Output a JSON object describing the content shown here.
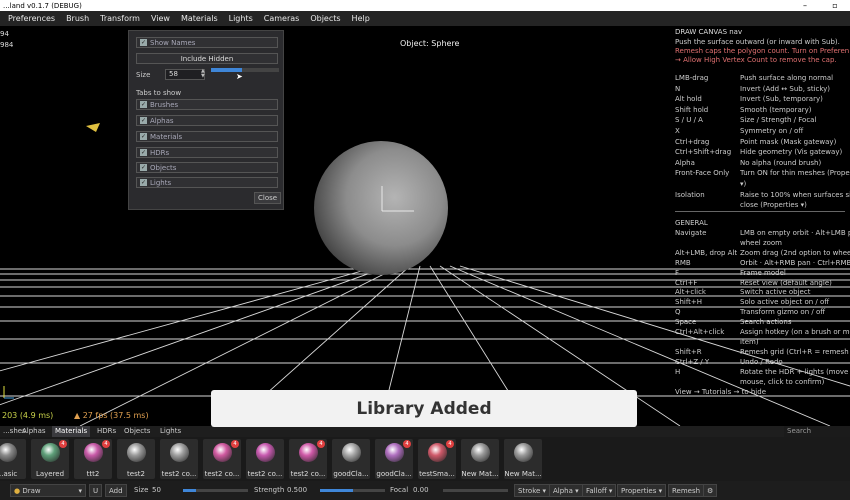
{
  "window": {
    "title": "...land v0.1.7 (DEBUG)",
    "minimize": "–",
    "maximize": "▫"
  },
  "menu": [
    "Preferences",
    "Brush",
    "Transform",
    "View",
    "Materials",
    "Lights",
    "Cameras",
    "Objects",
    "Help"
  ],
  "viewport": {
    "stats_top_left": [
      "94",
      "984"
    ],
    "object_label": "Object: Sphere",
    "fps_left": "203  (4.9 ms)",
    "fps_right": "▲  27 fps  (37.5 ms)"
  },
  "visibility_panel": {
    "show_names": "Show Names",
    "include_hidden": "Include Hidden",
    "size_label": "Size",
    "size_value": "58",
    "size_fraction": 0.45,
    "tabs_to_show": "Tabs to show",
    "tabs": [
      "Brushes",
      "Alphas",
      "Materials",
      "HDRs",
      "Objects",
      "Lights"
    ],
    "close": "Close"
  },
  "help": {
    "header": "DRAW    CANVAS nav",
    "intro": [
      "Push the surface outward (or inward with Sub).",
      "  Remesh caps the polygon count. Turn on Preferen",
      "→ Allow High Vertex Count to remove the cap."
    ],
    "rows": [
      {
        "key": "LMB-drag",
        "desc": "Push surface along normal"
      },
      {
        "key": "N",
        "desc": "Invert (Add ↔ Sub, sticky)"
      },
      {
        "key": "Alt hold",
        "desc": "Invert (Sub, temporary)"
      },
      {
        "key": "Shift hold",
        "desc": "Smooth (temporary)"
      },
      {
        "key": "S / U / A",
        "desc": "Size / Strength / Focal"
      },
      {
        "key": "X",
        "desc": "Symmetry on / off"
      },
      {
        "key": "Ctrl+drag",
        "desc": "Point mask (Mask gateway)"
      },
      {
        "key": "Ctrl+Shift+drag",
        "desc": "Hide geometry (Vis gateway)"
      },
      {
        "key": "Alpha",
        "desc": "No alpha (round brush)"
      },
      {
        "key": "Front-Face Only",
        "desc": "Turn ON for thin meshes (Propert"
      },
      {
        "key": "",
        "desc": "  ▾)"
      },
      {
        "key": "Isolation",
        "desc": "Raise to 100% when surfaces sit"
      },
      {
        "key": "",
        "desc": "close (Properties  ▾)"
      }
    ],
    "general": "GENERAL",
    "general_rows": [
      {
        "key": "Navigate",
        "desc": "LMB on empty orbit · Alt+LMB pa"
      },
      {
        "key": "",
        "desc": "wheel zoom"
      },
      {
        "key": "Alt+LMB, drop Alt",
        "desc": "Zoom drag (2nd option to whee"
      },
      {
        "key": "RMB",
        "desc": "Orbit · Alt+RMB pan · Ctrl+RMB z"
      },
      {
        "key": "F",
        "desc": "Frame model"
      },
      {
        "key": "Ctrl+F",
        "desc": "Reset view (default angle)"
      },
      {
        "key": "Alt+click",
        "desc": "Switch active object"
      },
      {
        "key": "Shift+H",
        "desc": "Solo active object on / off"
      },
      {
        "key": "Q",
        "desc": "Transform gizmo on / off"
      },
      {
        "key": "Space",
        "desc": "Search actions"
      },
      {
        "key": "Ctrl+Alt+click",
        "desc": "Assign hotkey (on a brush or men"
      },
      {
        "key": "",
        "desc": "item)"
      },
      {
        "key": "Shift+R",
        "desc": "Remesh grid (Ctrl+R = remesh no"
      },
      {
        "key": "Ctrl+Z / Y",
        "desc": "Undo / Redo"
      },
      {
        "key": "H",
        "desc": "Rotate the HDR + lights (move"
      },
      {
        "key": "",
        "desc": "mouse, click to confirm)"
      }
    ],
    "footer": "View → Tutorials → to hide"
  },
  "toast": "Library Added",
  "library_tabs": [
    "...shes",
    "Alphas",
    "Materials",
    "HDRs",
    "Objects",
    "Lights"
  ],
  "active_tab": "Materials",
  "search_placeholder": "Search",
  "materials": [
    {
      "label": "...asic",
      "color": "#8a8a8a",
      "badge": ""
    },
    {
      "label": "Layered",
      "color": "#5fa07a",
      "badge": "4"
    },
    {
      "label": "ttt2",
      "color": "#c85aa8",
      "badge": "4"
    },
    {
      "label": "test2",
      "color": "#9a9a9a",
      "badge": ""
    },
    {
      "label": "test2 co...",
      "color": "#a0a0a0",
      "badge": ""
    },
    {
      "label": "test2 co...",
      "color": "#d05aa0",
      "badge": "4"
    },
    {
      "label": "test2 co...",
      "color": "#c85ab0",
      "badge": ""
    },
    {
      "label": "test2 co...",
      "color": "#d05aa8",
      "badge": "4"
    },
    {
      "label": "goodCla...",
      "color": "#a8a8a8",
      "badge": ""
    },
    {
      "label": "goodCla...",
      "color": "#b070c0",
      "badge": "4"
    },
    {
      "label": "testSma...",
      "color": "#d05a6a",
      "badge": "4"
    },
    {
      "label": "New Mat...",
      "color": "#9a9a9a",
      "badge": ""
    },
    {
      "label": "New Mat...",
      "color": "#9a9a9a",
      "badge": ""
    }
  ],
  "toolbar": {
    "brush": "Draw",
    "u_button": "U",
    "add": "Add",
    "size_label": "Size",
    "size_value": "50",
    "size_fraction": 0.2,
    "strength_label": "Strength",
    "strength_value": "0.500",
    "strength_fraction": 0.5,
    "focal_label": "Focal",
    "focal_value": "0.00",
    "focal_fraction": 0.0,
    "stroke": "Stroke ▾",
    "alpha": "Alpha ▾",
    "falloff": "Falloff ▾",
    "properties": "Properties ▾",
    "remesh": "Remesh",
    "settings_icon": "gear-icon"
  }
}
